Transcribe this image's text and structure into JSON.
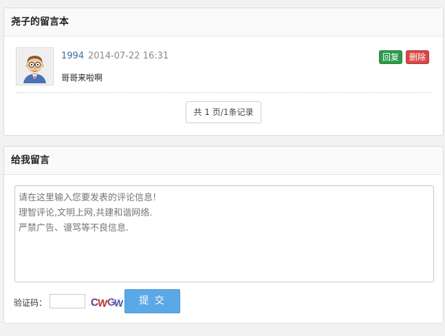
{
  "messages_panel": {
    "title": "尧子的留言本",
    "entries": [
      {
        "author": "1994",
        "time": "2014-07-22 16:31",
        "content": "哥哥来啦啊",
        "reply_label": "回复",
        "delete_label": "删除",
        "avatar_icon": "cartoon-man-avatar"
      }
    ],
    "pager": "共 1 页/1条记录"
  },
  "form_panel": {
    "title": "给我留言",
    "textarea_placeholder": "请在这里输入您要发表的评论信息!\n理智评论,文明上网,共建和谐网络.\n严禁广告、谩骂等不良信息.",
    "captcha_label": "验证码：",
    "captcha_input_value": "",
    "captcha_image_text": "CWGW",
    "submit_label": "提 交"
  },
  "colors": {
    "reply_button": "#2f9a4f",
    "delete_button": "#d94747",
    "submit_button": "#5ba8e6",
    "author_link": "#3b6f9c"
  }
}
